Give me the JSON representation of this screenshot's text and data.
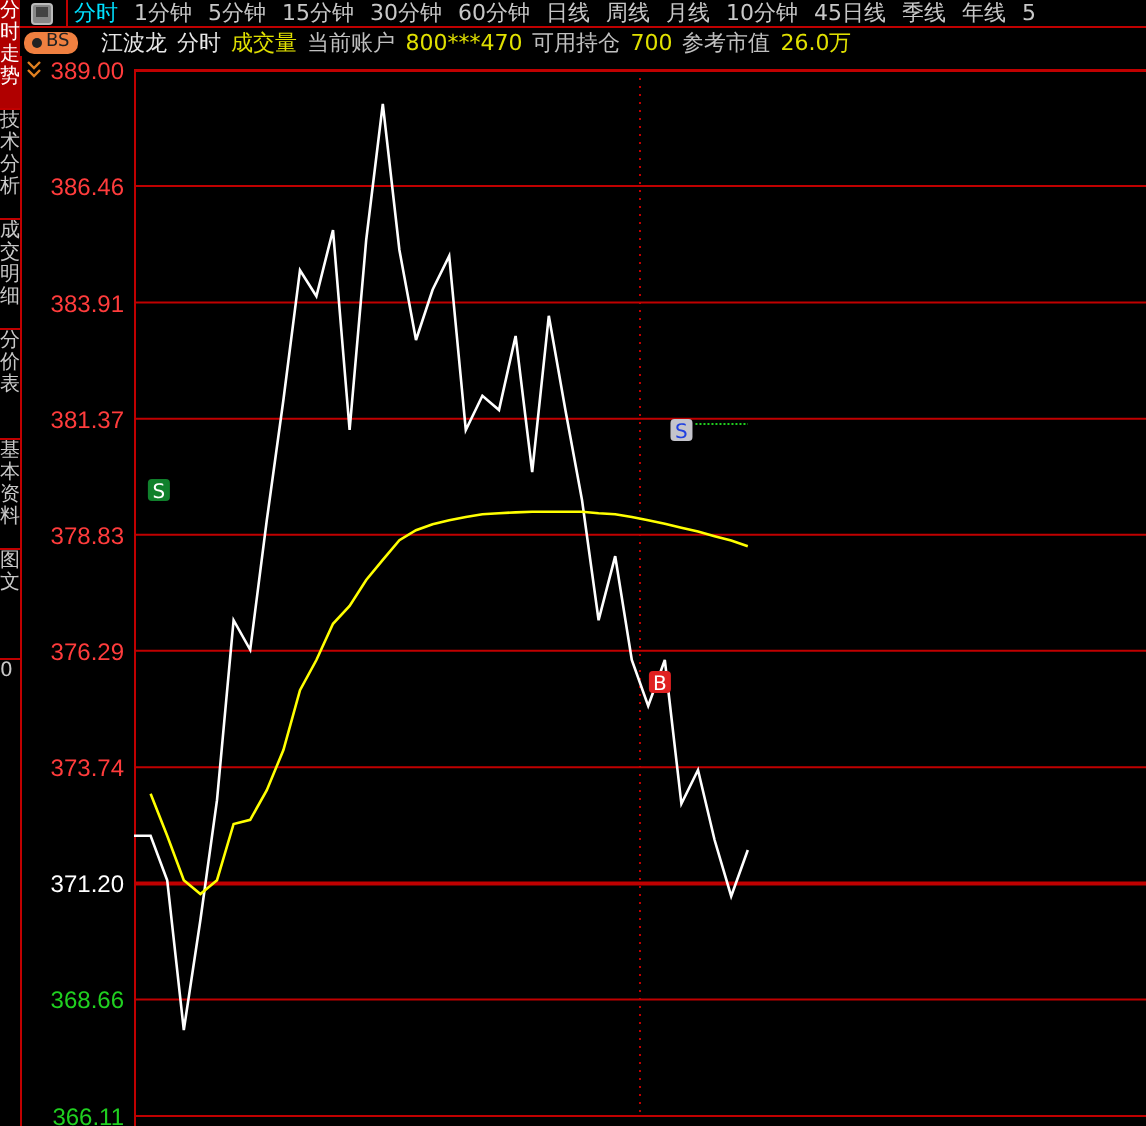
{
  "sidebar": {
    "tabs": [
      {
        "label": "分时走势",
        "selected": true
      },
      {
        "label": "技术分析",
        "selected": false
      },
      {
        "label": "成交明细",
        "selected": false
      },
      {
        "label": "分价表",
        "selected": false
      },
      {
        "label": "基本资料",
        "selected": false
      },
      {
        "label": "图文",
        "selected": false
      }
    ],
    "footer": "0"
  },
  "period_tabs": [
    {
      "label": "分时",
      "selected": true
    },
    {
      "label": "1分钟",
      "selected": false
    },
    {
      "label": "5分钟",
      "selected": false
    },
    {
      "label": "15分钟",
      "selected": false
    },
    {
      "label": "30分钟",
      "selected": false
    },
    {
      "label": "60分钟",
      "selected": false
    },
    {
      "label": "日线",
      "selected": false
    },
    {
      "label": "周线",
      "selected": false
    },
    {
      "label": "月线",
      "selected": false
    },
    {
      "label": "10分钟",
      "selected": false
    },
    {
      "label": "45日线",
      "selected": false
    },
    {
      "label": "季线",
      "selected": false
    },
    {
      "label": "年线",
      "selected": false
    },
    {
      "label": "5",
      "selected": false
    }
  ],
  "header": {
    "badge": "BS",
    "items": [
      {
        "text": "江波龙",
        "kind": "name"
      },
      {
        "text": "分时",
        "kind": "name"
      },
      {
        "text": "成交量",
        "kind": "value"
      },
      {
        "text": "当前账户",
        "kind": "label"
      },
      {
        "text": "800***470",
        "kind": "value"
      },
      {
        "text": "可用持仓",
        "kind": "label"
      },
      {
        "text": "700",
        "kind": "value"
      },
      {
        "text": "参考市值",
        "kind": "label"
      },
      {
        "text": "26.0万",
        "kind": "value"
      }
    ]
  },
  "chart": {
    "markers": [
      {
        "label": "S",
        "kind": "trade",
        "color": "#10802c"
      },
      {
        "label": "S",
        "kind": "pending",
        "color": "#c4c4cc"
      },
      {
        "label": "B",
        "kind": "trade",
        "color": "#e02020"
      }
    ],
    "chart_data": {
      "type": "line",
      "grid": true,
      "ref_lines": [
        {
          "axis": "y",
          "value": 371.2
        }
      ],
      "categories": [
        null,
        null,
        null,
        null,
        null,
        null,
        null,
        null,
        null,
        null,
        null,
        null,
        null,
        null,
        null,
        null,
        null,
        null,
        null,
        null,
        null,
        null,
        null,
        null,
        null,
        null,
        null,
        null,
        null,
        null,
        null,
        null,
        null,
        null,
        null,
        null,
        null,
        null,
        null,
        null,
        null,
        null,
        null,
        null,
        null,
        null,
        null,
        null,
        null,
        null,
        null,
        null,
        null,
        null,
        null,
        null,
        null,
        null,
        null,
        null,
        null,
        null
      ],
      "ylim": [
        366.11,
        389.0
      ],
      "yticks": [
        {
          "value": 389.0,
          "label": "389.00"
        },
        {
          "value": 386.46,
          "label": "386.46"
        },
        {
          "value": 383.91,
          "label": "383.91"
        },
        {
          "value": 381.37,
          "label": "381.37"
        },
        {
          "value": 378.83,
          "label": "378.83"
        },
        {
          "value": 376.29,
          "label": "376.29"
        },
        {
          "value": 373.74,
          "label": "373.74"
        },
        {
          "value": 371.2,
          "label": "371.20"
        },
        {
          "value": 368.66,
          "label": "368.66"
        },
        {
          "value": 366.11,
          "label": "366.11"
        }
      ],
      "series": [
        {
          "color": "#ffffff",
          "values": [
            372.24,
            372.24,
            371.27,
            367.99,
            370.4,
            373.02,
            376.96,
            376.31,
            379.15,
            381.78,
            384.62,
            384.05,
            385.5,
            381.12,
            385.28,
            388.26,
            385.06,
            383.09,
            384.19,
            384.93,
            381.12,
            381.87,
            381.56,
            383.18,
            380.2,
            383.62,
            381.56,
            379.59,
            376.96,
            378.36,
            376.09,
            375.08,
            376.09,
            372.94,
            373.68,
            372.15,
            370.92,
            371.93,
            null,
            null,
            null,
            null,
            null,
            null,
            null,
            null,
            null,
            null,
            null,
            null,
            null,
            null,
            null,
            null,
            null,
            null,
            null,
            null,
            null,
            null,
            null,
            null
          ]
        },
        {
          "color": "#ffff00",
          "values": [
            null,
            373.16,
            372.24,
            371.27,
            370.97,
            371.27,
            372.5,
            372.59,
            373.24,
            374.12,
            375.43,
            376.09,
            376.88,
            377.27,
            377.84,
            378.28,
            378.71,
            378.93,
            379.06,
            379.15,
            379.22,
            379.28,
            379.3,
            379.32,
            379.33,
            379.33,
            379.33,
            379.33,
            379.3,
            379.28,
            379.22,
            379.15,
            379.07,
            378.98,
            378.9,
            378.8,
            378.7,
            378.58,
            null,
            null,
            null,
            null,
            null,
            null,
            null,
            null,
            null,
            null,
            null,
            null,
            null,
            null,
            null,
            null,
            null,
            null,
            null,
            null,
            null,
            null,
            null,
            null
          ]
        }
      ]
    }
  }
}
